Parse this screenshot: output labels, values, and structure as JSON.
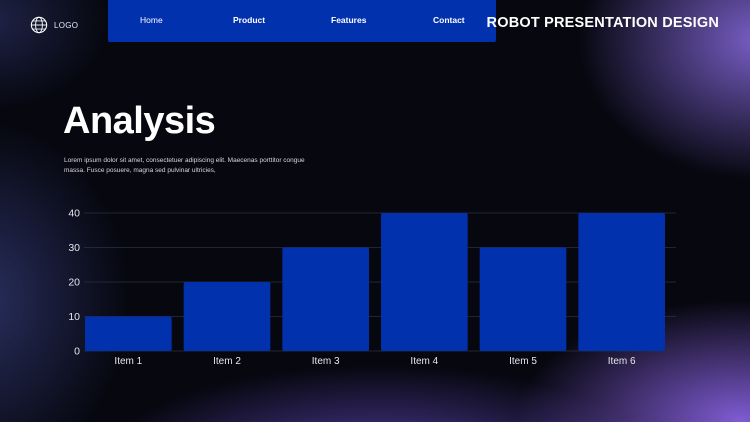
{
  "header": {
    "logo_label": "LOGO",
    "nav": [
      "Home",
      "Product",
      "Features",
      "Contact"
    ],
    "brand_title": "ROBOT PRESENTATION DESIGN"
  },
  "main": {
    "title": "Analysis",
    "description": "Lorem ipsum dolor sit amet, consectetuer adipiscing elit. Maecenas porttitor congue massa. Fusce posuere, magna sed pulvinar ultricies,"
  },
  "colors": {
    "bar": "#0231ae",
    "nav": "#0231ae",
    "grid": "#2c2f44"
  },
  "chart_data": {
    "type": "bar",
    "categories": [
      "Item 1",
      "Item 2",
      "Item 3",
      "Item 4",
      "Item 5",
      "Item 6"
    ],
    "values": [
      10,
      20,
      30,
      40,
      30,
      40
    ],
    "ylim": [
      0,
      40
    ],
    "yticks": [
      0,
      10,
      20,
      30,
      40
    ],
    "grid": true,
    "title": "",
    "xlabel": "",
    "ylabel": ""
  }
}
